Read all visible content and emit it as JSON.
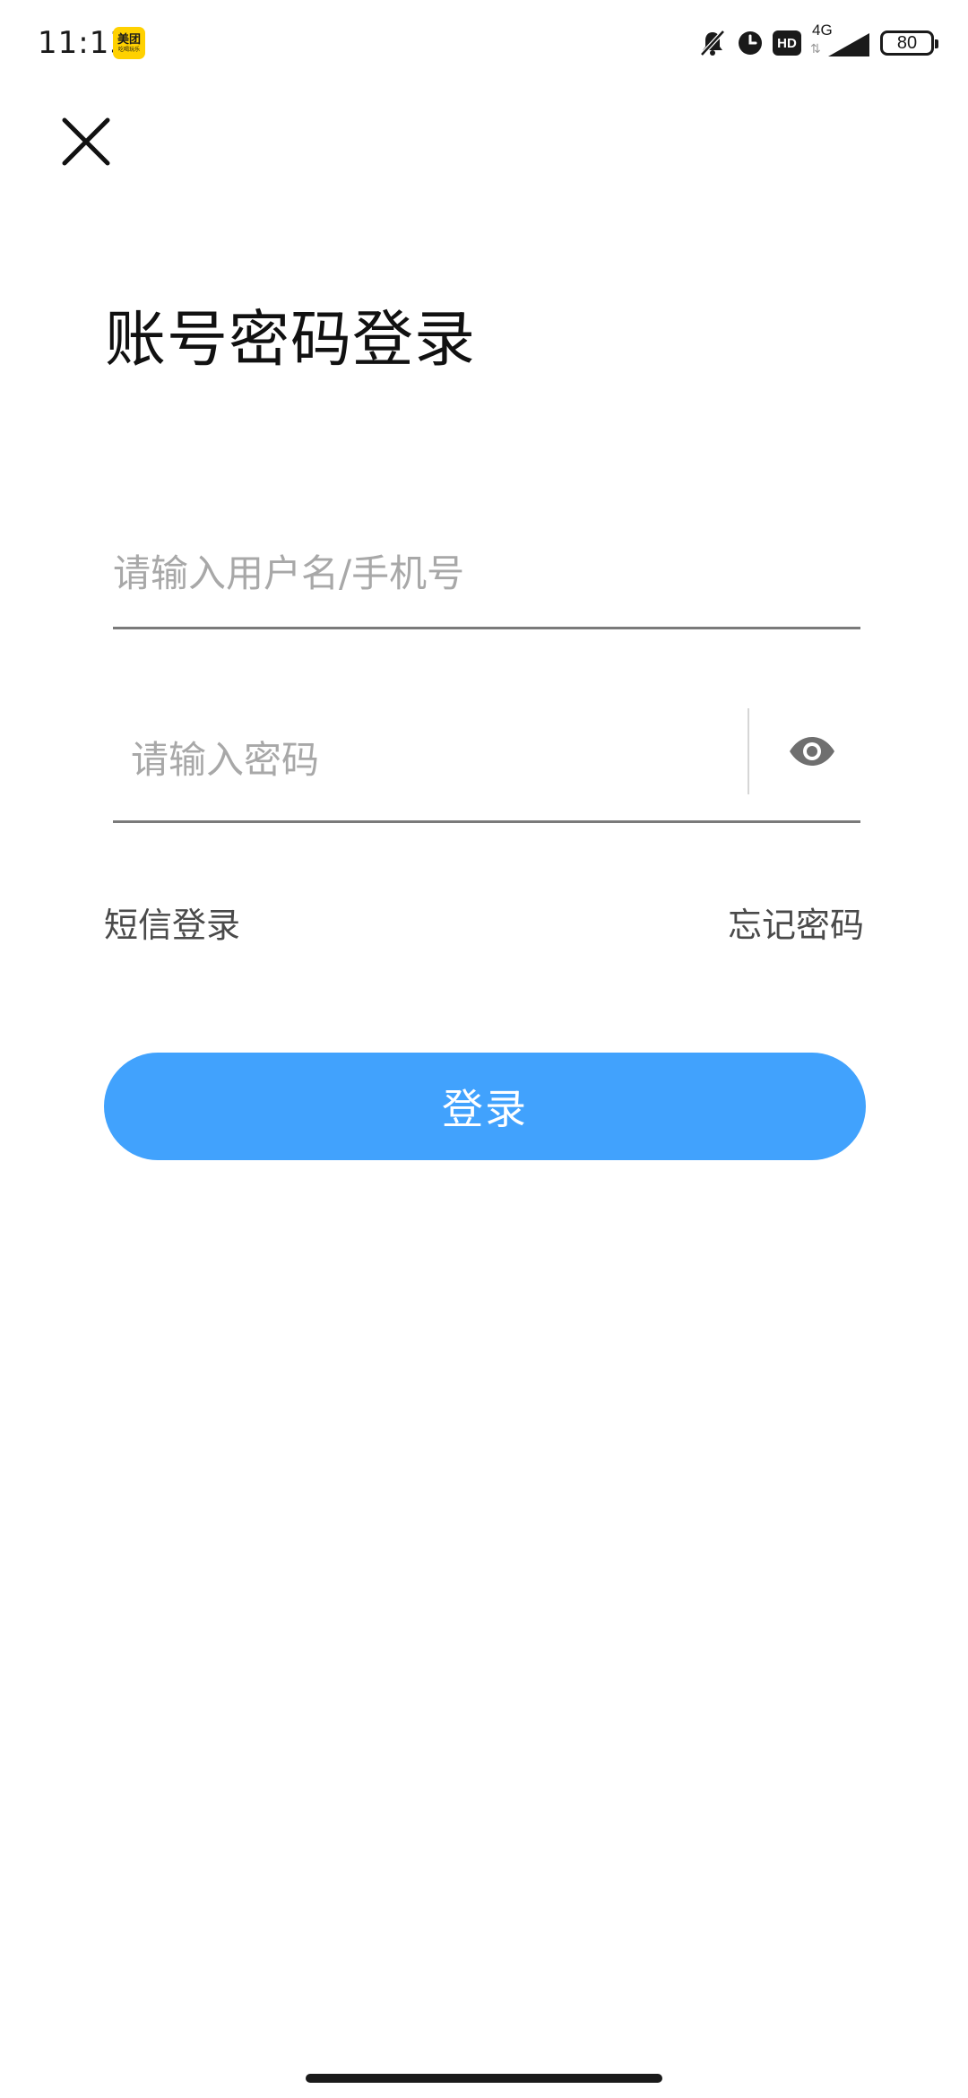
{
  "status_bar": {
    "time": "11:13",
    "app_badge": {
      "main": "美团",
      "sub": "吃喝玩乐"
    },
    "hd": "HD",
    "network": "4G",
    "network_arrows": "⇅",
    "battery": "80",
    "icons": [
      "mute-bell-icon",
      "alarm-clock-icon",
      "hd-icon",
      "signal-icon",
      "battery-icon"
    ]
  },
  "header": {
    "close_icon": "close-icon"
  },
  "main": {
    "title": "账号密码登录",
    "username": {
      "value": "",
      "placeholder": "请输入用户名/手机号"
    },
    "password": {
      "value": "",
      "placeholder": "请输入密码",
      "toggle_icon": "eye-icon"
    },
    "sms_login_label": "短信登录",
    "forgot_password_label": "忘记密码",
    "login_button_label": "登录"
  },
  "colors": {
    "primary": "#41a2fd",
    "title": "#111111",
    "placeholder": "#a8a8a8",
    "link": "#4a4a4a",
    "underline": "#7a7a7a"
  }
}
